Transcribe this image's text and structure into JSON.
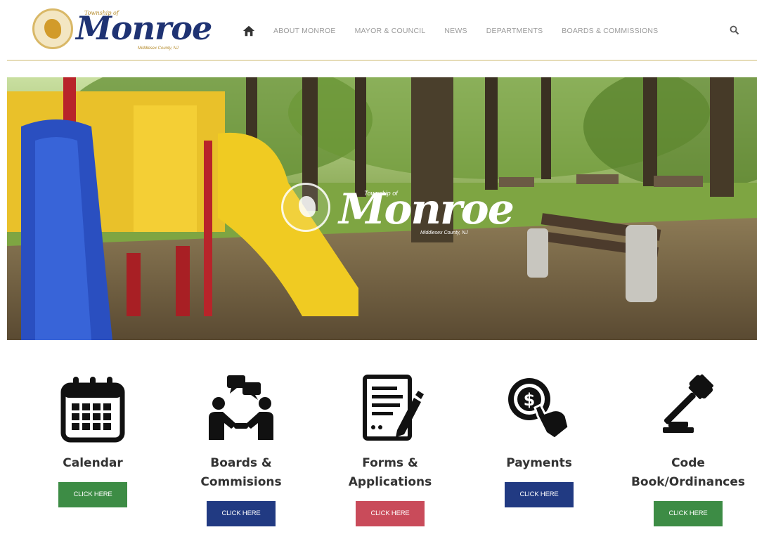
{
  "header": {
    "logo": {
      "top_text": "Township of",
      "name": "Monroe",
      "county": "Middlesex County, NJ"
    },
    "nav": {
      "home_icon": "home-icon",
      "items": [
        "ABOUT MONROE",
        "MAYOR & COUNCIL",
        "NEWS",
        "DEPARTMENTS",
        "BOARDS & COMMISSIONS"
      ],
      "search_icon": "search-icon"
    }
  },
  "hero": {
    "overlay_logo": {
      "top_text": "Township of",
      "name": "Monroe",
      "county": "Middlesex County, NJ"
    }
  },
  "quick_links": [
    {
      "icon": "calendar-icon",
      "label": "Calendar",
      "button": "CLICK HERE",
      "button_color": "#3d8c45"
    },
    {
      "icon": "meeting-icon",
      "label": "Boards & Commisions",
      "button": "CLICK HERE",
      "button_color": "#213a82"
    },
    {
      "icon": "form-icon",
      "label": "Forms & Applications",
      "button": "CLICK HERE",
      "button_color": "#c94b5a"
    },
    {
      "icon": "payment-icon",
      "label": "Payments",
      "button": "CLICK HERE",
      "button_color": "#213a82"
    },
    {
      "icon": "gavel-icon",
      "label": "Code Book/Ordinances",
      "button": "CLICK HERE",
      "button_color": "#3d8c45"
    }
  ]
}
